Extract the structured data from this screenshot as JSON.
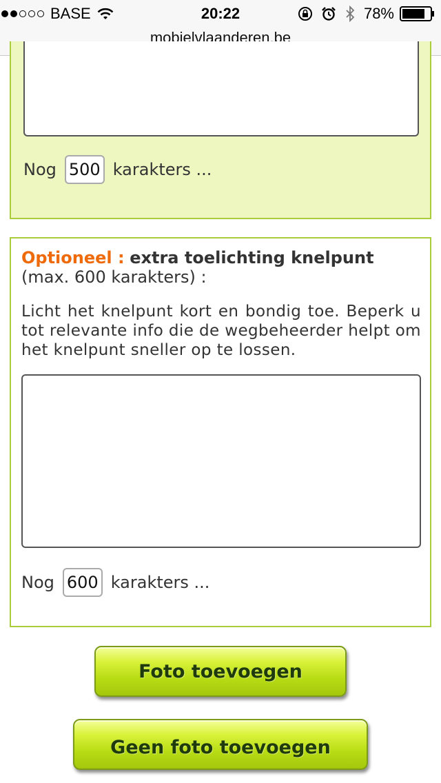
{
  "status_bar": {
    "carrier": "BASE",
    "time": "20:22",
    "battery": "78%",
    "signal_bars_filled": 2,
    "signal_bars_total": 5
  },
  "address_bar": {
    "url": "mobielvlaanderen.be"
  },
  "top_section": {
    "counter_prefix": "Nog",
    "counter_value": "500",
    "counter_suffix": "karakters ..."
  },
  "mid_section": {
    "optional_label": "Optioneel :",
    "title": "extra toelichting knelpunt",
    "limit_note": "(max. 600 karakters) :",
    "description": "Licht het knelpunt kort en bondig toe. Beperk u tot relevante info die de wegbeheerder helpt om het knelpunt sneller op te lossen.",
    "textarea_value": "",
    "counter_prefix": "Nog",
    "counter_value": "600",
    "counter_suffix": "karakters ..."
  },
  "buttons": {
    "add_photo": "Foto toevoegen",
    "no_photo": "Geen foto toevoegen"
  },
  "colors": {
    "panel_border": "#a9cd3b",
    "panel_fill": "#eef7c0",
    "optional_label": "#ee6a0a",
    "button_green": "#c8e61f"
  }
}
